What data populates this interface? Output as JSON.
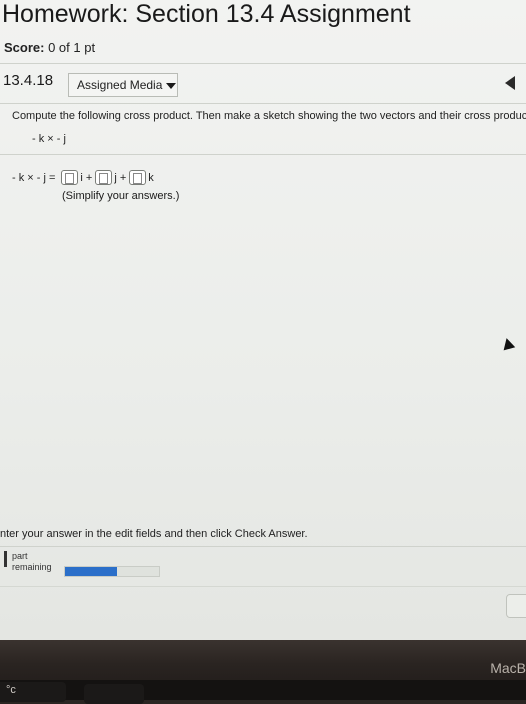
{
  "header": {
    "title": "Homework: Section 13.4 Assignment",
    "score_label": "Score:",
    "score_value": "0 of 1 pt"
  },
  "question": {
    "number": "13.4.18",
    "media_button": "Assigned Media",
    "prompt": "Compute the following cross product. Then make a sketch showing the two vectors and their cross product.",
    "expression": "- k × - j"
  },
  "answer": {
    "lhs": "- k × - j =",
    "units": [
      "i +",
      "j +",
      "k"
    ],
    "hint": "(Simplify your answers.)"
  },
  "footer": {
    "instruction": "nter your answer in the edit fields and then click Check Answer.",
    "part_label_1": "part",
    "part_label_2": "remaining",
    "progress_fraction": 0.55
  },
  "device": {
    "brand_partial": "MacB",
    "esc_partial": "°c"
  },
  "colors": {
    "progress_fill": "#2b6fc9",
    "page_background": "#eef0ed"
  }
}
